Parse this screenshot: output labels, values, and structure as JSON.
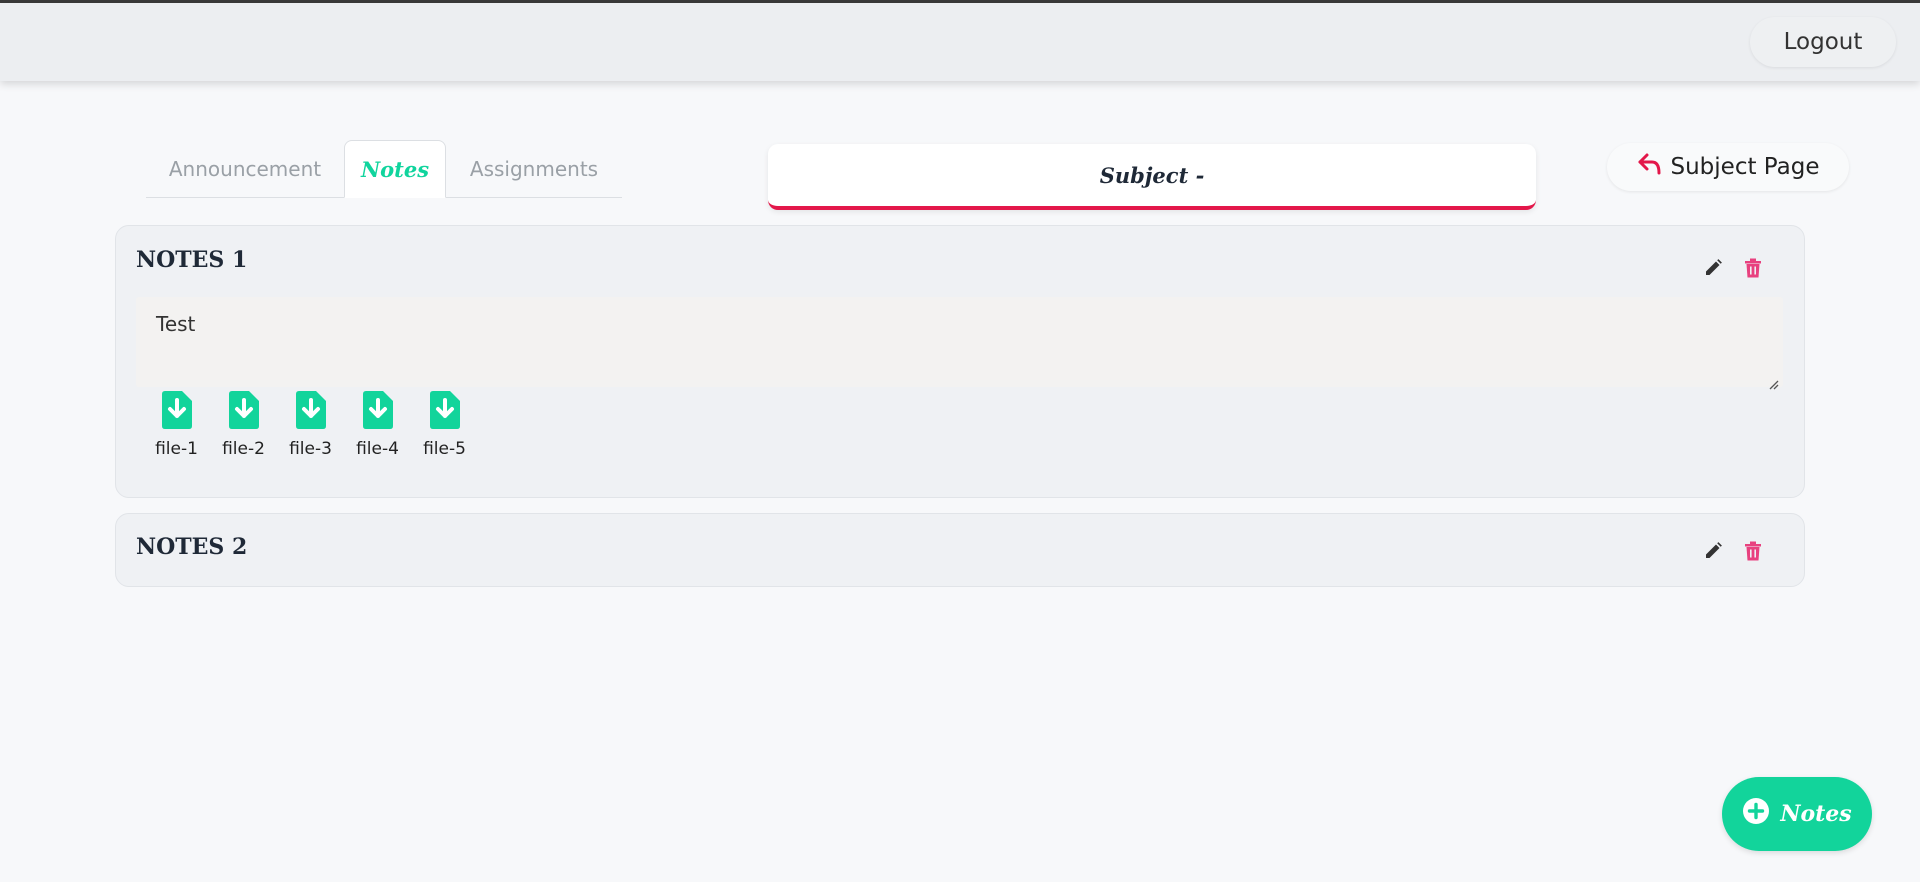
{
  "navbar": {
    "logout_label": "Logout"
  },
  "tabs": [
    {
      "label": "Announcement",
      "active": false
    },
    {
      "label": "Notes",
      "active": true
    },
    {
      "label": "Assignments",
      "active": false
    }
  ],
  "subject": {
    "title": "Subject -"
  },
  "subject_page": {
    "label": "Subject Page",
    "icon": "reply-arrow-icon"
  },
  "notes": [
    {
      "title": "NOTES 1",
      "body": "Test",
      "files": [
        "file-1",
        "file-2",
        "file-3",
        "file-4",
        "file-5"
      ]
    },
    {
      "title": "NOTES 2"
    }
  ],
  "fab": {
    "label": "Notes",
    "icon": "plus-circle-icon"
  },
  "colors": {
    "accent_green": "#12d49b",
    "accent_red": "#e3174a",
    "delete_pink": "#e8417f"
  }
}
